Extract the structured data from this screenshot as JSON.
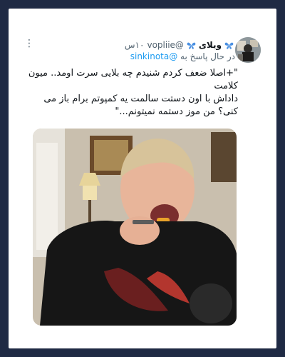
{
  "tweet": {
    "display_name": "ویلای",
    "handle": "@vopliie",
    "timestamp": "۱۰س",
    "reply_prefix": "در حال پاسخ به",
    "reply_to": "@sinkinota",
    "text_lines": [
      "\"+اصلا ضعف کردم شنیدم چه بلایی سرت اومد.. میون کلامت",
      "داداش با اون دستت سالمت یه کمپوتم برام باز می کنی؟ من موز دستمه نمیتونم...\""
    ]
  },
  "icons": {
    "butterfly": "butterfly-emoji-icon",
    "more": "more-options-icon"
  },
  "colors": {
    "background": "#1f2a44",
    "card": "#ffffff",
    "link": "#1d9bf0",
    "butterfly": "#4a90e2"
  }
}
